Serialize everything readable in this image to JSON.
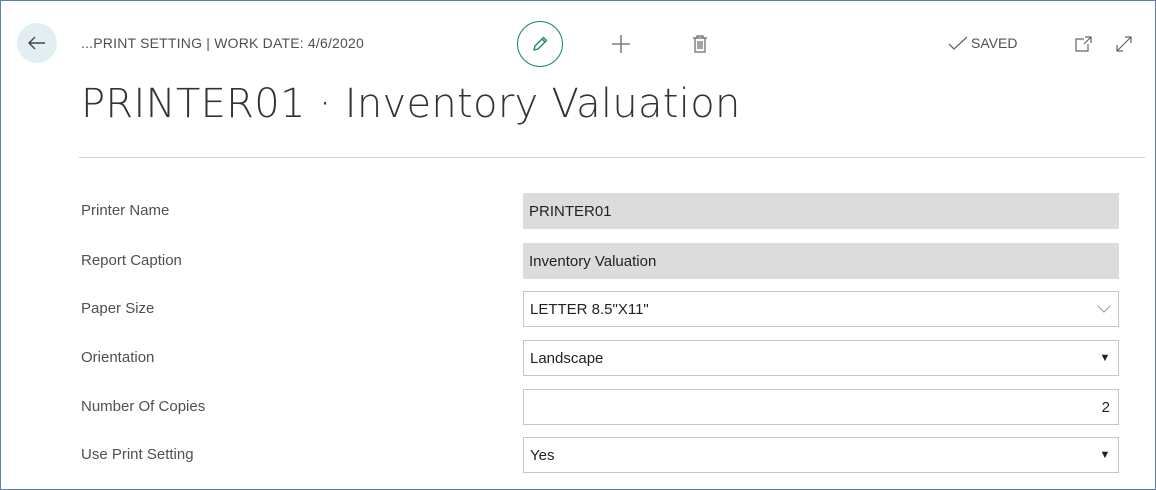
{
  "header": {
    "breadcrumb": "...PRINT SETTING | WORK DATE: 4/6/2020",
    "saved_label": "SAVED",
    "colors": {
      "accent_green": "#1f8a5c",
      "back_bg": "#e3eef2",
      "frame_border": "#5b7fb0"
    },
    "icons": [
      "back-arrow-icon",
      "pencil-icon",
      "plus-icon",
      "trash-icon",
      "checkmark-icon",
      "open-new-window-icon",
      "expand-icon"
    ]
  },
  "page": {
    "title": "PRINTER01 · Inventory Valuation"
  },
  "fields": {
    "printer_name": {
      "label": "Printer Name",
      "value": "PRINTER01"
    },
    "report_caption": {
      "label": "Report Caption",
      "value": "Inventory Valuation"
    },
    "paper_size": {
      "label": "Paper Size",
      "value": "LETTER 8.5\"X11\""
    },
    "orientation": {
      "label": "Orientation",
      "value": "Landscape"
    },
    "number_of_copies": {
      "label": "Number Of Copies",
      "value": "2"
    },
    "use_print_setting": {
      "label": "Use Print Setting",
      "value": "Yes"
    }
  }
}
